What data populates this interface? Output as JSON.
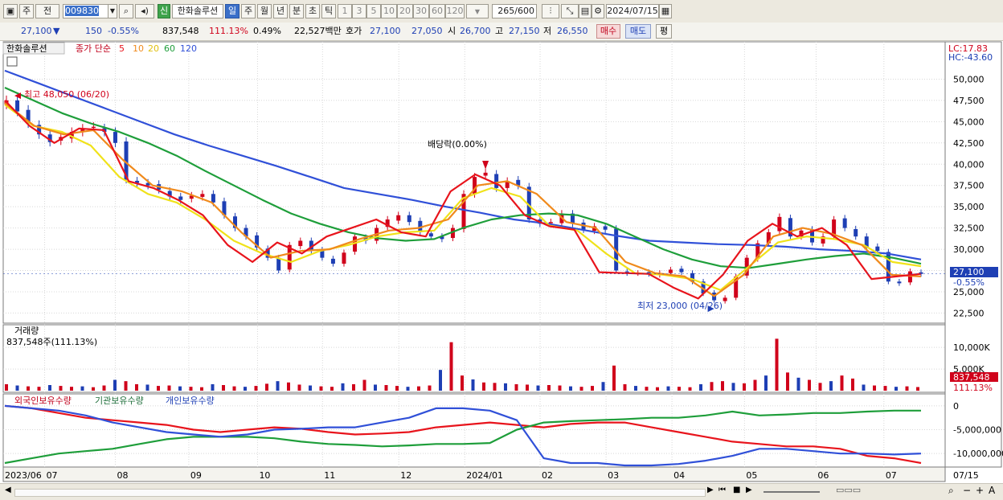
{
  "toolbar": {
    "buttons": [
      "주",
      "전"
    ],
    "code": "009830",
    "stock_badge": "신",
    "stock_name": "한화솔루션",
    "periods": [
      "일",
      "주",
      "월",
      "년",
      "분",
      "초",
      "틱"
    ],
    "active_period": "일",
    "intervals": [
      "1",
      "3",
      "5",
      "10",
      "20",
      "30",
      "60",
      "120"
    ],
    "count": "265",
    "count_max": "/600",
    "date": "2024/07/15"
  },
  "info": {
    "price": "27,100",
    "change": "150",
    "change_pct": "-0.55%",
    "volume": "837,548",
    "volume_ratio": "111.13%",
    "turnover_pct": "0.49%",
    "amount": "22,527백만",
    "quote_label": "호가",
    "ask": "27,100",
    "bid": "27,050",
    "open_label": "시",
    "open": "26,700",
    "high_label": "고",
    "high": "27,150",
    "low_label": "저",
    "low": "26,550",
    "sell_label": "매수",
    "buy_label": "매도",
    "avg_label": "평"
  },
  "legend": {
    "name": "한화솔루션",
    "label": "종가 단순",
    "ma5": "5",
    "ma10": "10",
    "ma20": "20",
    "ma60": "60",
    "ma120": "120",
    "colors": {
      "ma5": "#e8141c",
      "ma10": "#f08a1c",
      "ma20": "#f0e21a",
      "ma60": "#1e9e3a",
      "ma120": "#3050d8"
    }
  },
  "annotations": {
    "lc": "LC:17.83",
    "hc": "HC:-43.60",
    "high_mark": "최고 48,050 (06/20)",
    "low_mark": "최저 23,000 (04/26)",
    "dividend": "배당락(0.00%)",
    "last_price": "27,100",
    "last_pct": "-0.55%"
  },
  "volume_panel": {
    "title": "거래량",
    "value": "837,548주(111.13%)",
    "last_value": "837,548",
    "last_pct": "111.13%"
  },
  "holding_panel": {
    "foreign": "외국인보유수량",
    "institution": "기관보유수량",
    "individual": "개인보유수량"
  },
  "chart_data": [
    {
      "type": "line",
      "name": "price",
      "y_ticks": [
        "50,000",
        "47,500",
        "45,000",
        "42,500",
        "40,000",
        "37,500",
        "35,000",
        "32,500",
        "30,000",
        "27,500",
        "25,000",
        "22,500"
      ],
      "ylim": [
        21500,
        52500
      ],
      "x_labels": [
        "2023/06",
        "07",
        "08",
        "09",
        "10",
        "11",
        "12",
        "2024/01",
        "02",
        "03",
        "04",
        "05",
        "06",
        "07",
        "07/15"
      ],
      "close_series": [
        47500,
        46200,
        44800,
        43500,
        42600,
        43200,
        43800,
        44200,
        44400,
        43800,
        42500,
        38200,
        37800,
        37500,
        37000,
        36200,
        35800,
        36300,
        36500,
        35500,
        34000,
        32500,
        31500,
        30200,
        29000,
        27500,
        30500,
        31000,
        29800,
        29000,
        28300,
        29600,
        31500,
        31000,
        32500,
        33500,
        34000,
        33200,
        32000,
        31500,
        31200,
        32500,
        36500,
        38500,
        39000,
        37200,
        38000,
        37500,
        33500,
        33000,
        33200,
        34200,
        33000,
        32300,
        32700,
        32300,
        27500,
        27200,
        27200,
        27100,
        27200,
        27600,
        27300,
        26200,
        24800,
        24000,
        24300,
        26800,
        29000,
        30700,
        32000,
        33800,
        31500,
        32200,
        30800,
        31500,
        33500,
        32500,
        31500,
        30200,
        29800,
        26200,
        26000,
        27400,
        27100
      ],
      "ma120_series": [
        51000,
        49500,
        48000,
        46500,
        45000,
        43500,
        42200,
        41000,
        39800,
        38500,
        37200,
        36500,
        35800,
        35000,
        34300,
        33500,
        33000,
        32300,
        31600,
        31000,
        30800,
        30600,
        30500,
        30300,
        30000,
        29800,
        29500,
        28800
      ],
      "ma60_series": [
        49000,
        47500,
        46000,
        44800,
        43800,
        42500,
        41000,
        39200,
        37500,
        35800,
        34200,
        33000,
        32000,
        31300,
        31000,
        31200,
        32500,
        33500,
        34000,
        34200,
        34000,
        33000,
        31500,
        30000,
        28800,
        28000,
        27800,
        28300,
        28800,
        29200,
        29500,
        29000,
        28300
      ],
      "ma20_series": [
        47000,
        44500,
        43800,
        42200,
        38500,
        36500,
        35500,
        33500,
        31000,
        29500,
        28500,
        29800,
        30500,
        31500,
        32000,
        32200,
        36000,
        37200,
        36200,
        32800,
        32200,
        29500,
        27200,
        27000,
        26500,
        25200,
        28000,
        30800,
        31500,
        31200,
        30500,
        28500,
        28000
      ],
      "ma10_series": [
        47200,
        44500,
        43500,
        44000,
        40500,
        37500,
        36800,
        35500,
        32000,
        29000,
        29800,
        30000,
        31200,
        32200,
        32500,
        33500,
        37500,
        38000,
        36500,
        33200,
        32500,
        28500,
        27200,
        26800,
        24500,
        27000,
        31500,
        32500,
        31800,
        30500,
        27000,
        26800
      ],
      "ma5_series": [
        47500,
        44500,
        42500,
        44200,
        44000,
        38000,
        37200,
        35800,
        34000,
        30500,
        28500,
        30800,
        29500,
        31500,
        32500,
        33500,
        32000,
        31500,
        36800,
        38800,
        37500,
        34000,
        32700,
        32300,
        27300,
        27200,
        27100,
        25500,
        24200,
        27000,
        31000,
        33000,
        31500,
        32500,
        30500,
        26500,
        26800,
        27100
      ],
      "marks": {
        "high": 48050,
        "low": 23000,
        "last": 27100
      }
    },
    {
      "type": "bar",
      "name": "volume",
      "y_ticks": [
        "10,000K",
        "5,000K"
      ],
      "ylim": [
        0,
        13000000
      ],
      "values": [
        1500000,
        1200000,
        1000000,
        900000,
        1300000,
        1100000,
        900000,
        1000000,
        800000,
        1200000,
        2500000,
        2200000,
        1500000,
        1400000,
        1100000,
        1200000,
        1000000,
        900000,
        800000,
        1500000,
        1300000,
        1000000,
        900000,
        1100000,
        1600000,
        2200000,
        1900000,
        1400000,
        1200000,
        1000000,
        900000,
        1700000,
        1500000,
        2500000,
        1400000,
        1300000,
        1100000,
        900000,
        1000000,
        1200000,
        4800000,
        11200000,
        3500000,
        2600000,
        1900000,
        1800000,
        1700000,
        1500000,
        1400000,
        1200000,
        1300000,
        1200000,
        1000000,
        900000,
        1100000,
        2000000,
        5800000,
        1500000,
        1100000,
        900000,
        800000,
        1000000,
        900000,
        800000,
        1500000,
        2000000,
        2200000,
        1800000,
        1700000,
        2500000,
        3500000,
        12000000,
        4200000,
        3000000,
        2500000,
        1800000,
        2200000,
        3500000,
        2800000,
        1400000,
        1200000,
        1100000,
        900000,
        1000000,
        837548
      ]
    },
    {
      "type": "line",
      "name": "holdings",
      "y_ticks": [
        "0",
        "-5,000,000",
        "-10,000,000"
      ],
      "ylim": [
        -12500000,
        1500000
      ],
      "series": [
        {
          "name": "외국인보유수량",
          "color": "#e8141c",
          "values": [
            0,
            -500000,
            -1500000,
            -2500000,
            -3000000,
            -3500000,
            -4000000,
            -5000000,
            -5500000,
            -5000000,
            -4500000,
            -4800000,
            -5500000,
            -6000000,
            -5800000,
            -5500000,
            -4500000,
            -4000000,
            -3500000,
            -4000000,
            -4500000,
            -3800000,
            -3500000,
            -3500000,
            -4500000,
            -5500000,
            -6500000,
            -7500000,
            -8000000,
            -8500000,
            -8500000,
            -9000000,
            -10500000,
            -11000000,
            -12000000
          ]
        },
        {
          "name": "기관보유수량",
          "color": "#1e9e3a",
          "values": [
            -12000000,
            -11000000,
            -10000000,
            -9500000,
            -9000000,
            -8000000,
            -7000000,
            -6500000,
            -6500000,
            -6500000,
            -6800000,
            -7500000,
            -8000000,
            -8200000,
            -8500000,
            -8300000,
            -8000000,
            -8000000,
            -7800000,
            -5000000,
            -3500000,
            -3200000,
            -3000000,
            -2800000,
            -2500000,
            -2500000,
            -2000000,
            -1200000,
            -2000000,
            -1800000,
            -1500000,
            -1500000,
            -1200000,
            -1000000,
            -1000000
          ]
        },
        {
          "name": "개인보유수량",
          "color": "#3050d8",
          "values": [
            0,
            -500000,
            -1000000,
            -2000000,
            -3500000,
            -4500000,
            -5500000,
            -6000000,
            -6500000,
            -6000000,
            -5000000,
            -4800000,
            -4500000,
            -4500000,
            -3500000,
            -2500000,
            -500000,
            -500000,
            -1000000,
            -3000000,
            -11000000,
            -12000000,
            -12000000,
            -12500000,
            -12500000,
            -12200000,
            -11500000,
            -10500000,
            -9000000,
            -9000000,
            -9500000,
            -10000000,
            -10000000,
            -10200000,
            -10000000
          ]
        }
      ]
    }
  ]
}
